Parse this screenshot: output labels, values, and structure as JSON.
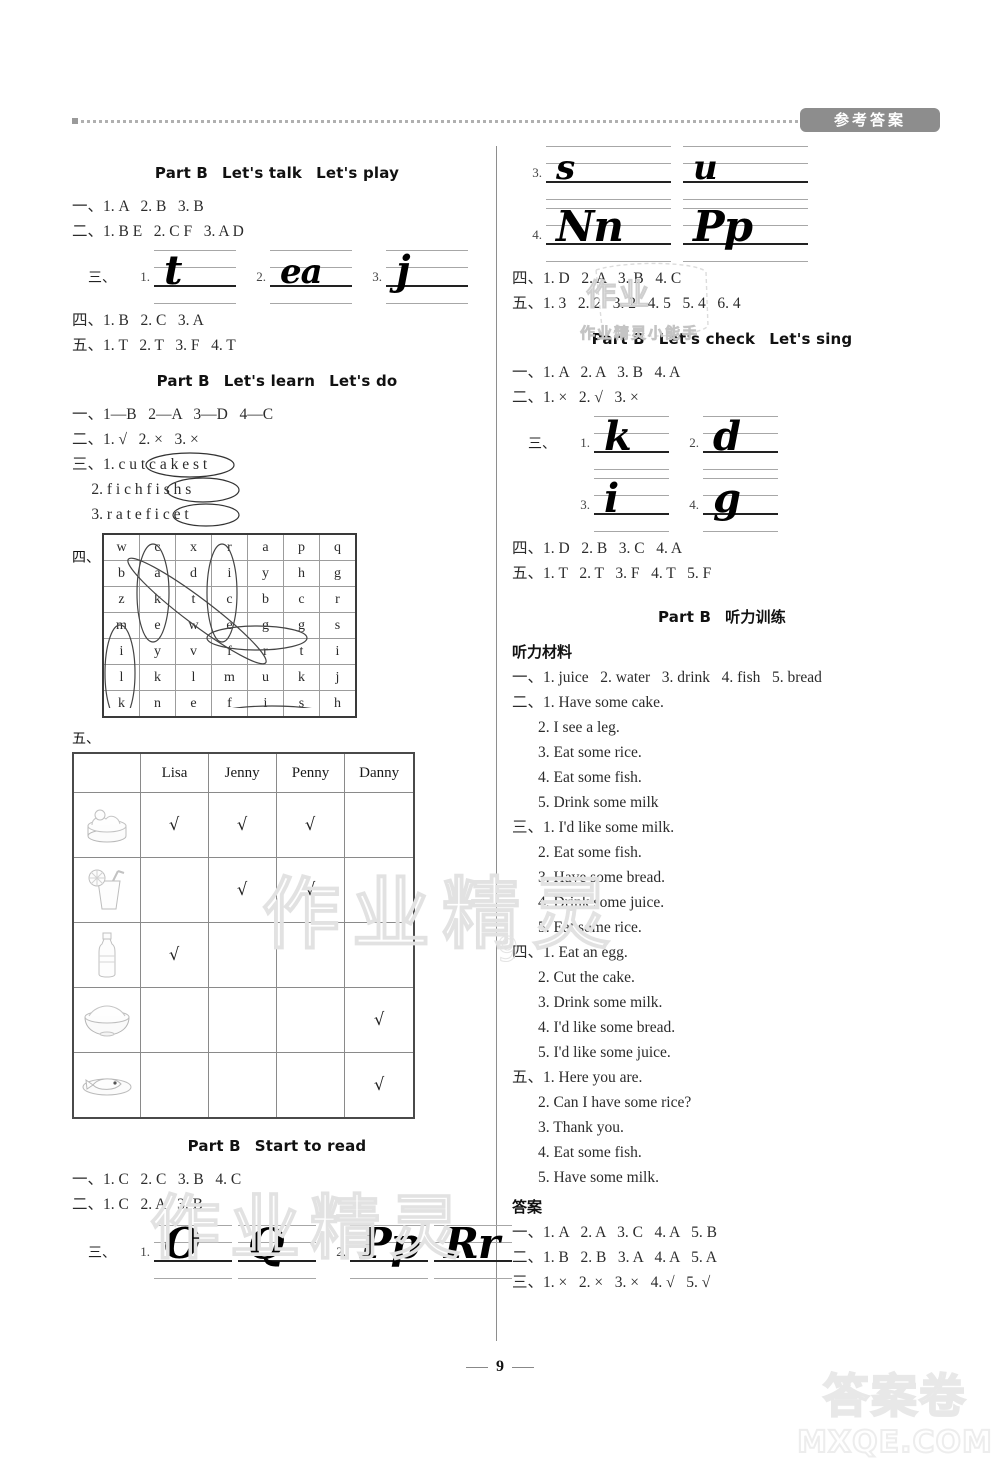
{
  "header": {
    "badge": "参考答案"
  },
  "page_number": "9",
  "watermarks": {
    "main": "作业精灵",
    "secondary": "作业精灵",
    "scribble_top": "作业",
    "scribble_sub": "作业精灵小能手",
    "footer_cn": "答案卷",
    "footer_en": "MXQE.COM",
    "side_digit": "9"
  },
  "left_column": {
    "sections": [
      {
        "title": [
          "Part B",
          "Let's talk",
          "Let's play"
        ],
        "lines": [
          "一、1. A   2. B   3. B",
          "二、1. B E   2. C F   3. A D"
        ],
        "staves": {
          "label": "三、",
          "items": [
            {
              "num": "1.",
              "glyph": "t"
            },
            {
              "num": "2.",
              "glyph": "ea"
            },
            {
              "num": "3.",
              "glyph": "j"
            }
          ]
        },
        "lines_after": [
          "四、1. B   2. C   3. A",
          "五、1. T   2. T   3. F   4. T"
        ]
      },
      {
        "title": [
          "Part B",
          "Let's learn",
          "Let's do"
        ],
        "lines": [
          "一、1—B   2—A   3—D   4—C",
          "二、1. √   2. ×   3. ×",
          "三、1. c u t c a k e s t",
          "     2. f i c h f i s h s",
          "     3. r a t e f i c e t"
        ],
        "circled": [
          {
            "line": 3,
            "text": "c a k e"
          },
          {
            "line": 4,
            "text": "f i s h"
          },
          {
            "line": 5,
            "text": "f i c e"
          }
        ]
      }
    ],
    "wordsearch": {
      "label": "四、",
      "grid": [
        [
          "w",
          "c",
          "x",
          "r",
          "a",
          "p",
          "q"
        ],
        [
          "b",
          "a",
          "d",
          "i",
          "y",
          "h",
          "g"
        ],
        [
          "z",
          "k",
          "t",
          "c",
          "b",
          "c",
          "r"
        ],
        [
          "m",
          "e",
          "w",
          "e",
          "g",
          "g",
          "s"
        ],
        [
          "i",
          "y",
          "v",
          "f",
          "r",
          "t",
          "i"
        ],
        [
          "l",
          "k",
          "l",
          "m",
          "u",
          "k",
          "j"
        ],
        [
          "k",
          "n",
          "e",
          "f",
          "i",
          "s",
          "h"
        ]
      ],
      "found_words": [
        "water",
        "cake",
        "rice",
        "egg",
        "milk",
        "fish"
      ]
    },
    "foodtable": {
      "label": "五、",
      "columns": [
        "",
        "Lisa",
        "Jenny",
        "Penny",
        "Danny"
      ],
      "rows": [
        {
          "icon": "cake-icon",
          "marks": [
            "√",
            "√",
            "√",
            ""
          ]
        },
        {
          "icon": "juice-icon",
          "marks": [
            "",
            "√",
            "√",
            ""
          ]
        },
        {
          "icon": "water-icon",
          "marks": [
            "√",
            "",
            "",
            ""
          ]
        },
        {
          "icon": "rice-icon",
          "marks": [
            "",
            "",
            "",
            "√"
          ]
        },
        {
          "icon": "fish-icon",
          "marks": [
            "",
            "",
            "",
            "√"
          ]
        }
      ]
    },
    "start_to_read": {
      "title": [
        "Part B",
        "Start to read"
      ],
      "lines": [
        "一、1. C   2. C   3. B   4. C",
        "二、1. C   2. A   3. B"
      ],
      "staves": {
        "label": "三、",
        "items": [
          {
            "num": "1.",
            "glyph": "O"
          },
          {
            "num": "",
            "glyph": "Q"
          },
          {
            "num": "2.",
            "glyph": "Pp"
          },
          {
            "num": "",
            "glyph": "Rr"
          }
        ]
      }
    }
  },
  "right_column": {
    "staves_top": {
      "items": [
        {
          "num": "3.",
          "glyph": "s"
        },
        {
          "num": "",
          "glyph": "u"
        },
        {
          "num": "4.",
          "glyph": "Nn"
        },
        {
          "num": "",
          "glyph": "Pp"
        }
      ]
    },
    "lines_top": [
      "四、1. D   2. A   3. B   4. C",
      "五、1. 3   2. 2   3. 2   4. 5   5. 4   6. 4"
    ],
    "lets_check": {
      "title": [
        "Part B",
        "Let's check",
        "Let's sing"
      ],
      "lines": [
        "一、1. A   2. A   3. B   4. A",
        "二、1. ×   2. √   3. ×"
      ],
      "staves": {
        "label": "三、",
        "items": [
          {
            "num": "1.",
            "glyph": "k"
          },
          {
            "num": "2.",
            "glyph": "d"
          },
          {
            "num": "3.",
            "glyph": "i"
          },
          {
            "num": "4.",
            "glyph": "g"
          }
        ]
      },
      "lines_after": [
        "四、1. D   2. B   3. C   4. A",
        "五、1. T   2. T   3. F   4. T   5. F"
      ]
    },
    "listening": {
      "title": [
        "Part B",
        "听力训练"
      ],
      "heading": "听力材料",
      "groups": [
        {
          "first": "一、1. juice   2. water   3. drink   4. fish   5. bread",
          "rest": []
        },
        {
          "first": "二、1. Have some cake.",
          "rest": [
            "2. I see a leg.",
            "3. Eat some rice.",
            "4. Eat some fish.",
            "5. Drink some milk"
          ]
        },
        {
          "first": "三、1. I'd like some milk.",
          "rest": [
            "2. Eat some fish.",
            "3. Have some bread.",
            "4. Drink some juice.",
            "5. Eat some rice."
          ]
        },
        {
          "first": "四、1. Eat an egg.",
          "rest": [
            "2. Cut the cake.",
            "3. Drink some milk.",
            "4. I'd like some bread.",
            "5. I'd like some juice."
          ]
        },
        {
          "first": "五、1. Here you are.",
          "rest": [
            "2. Can I have some rice?",
            "3. Thank you.",
            "4. Eat some fish.",
            "5. Have some milk."
          ]
        }
      ],
      "answers_heading": "答案",
      "answers": [
        "一、1. A   2. A   3. C   4. A   5. B",
        "二、1. B   2. B   3. A   4. A   5. A",
        "三、1. ×   2. ×   3. ×   4. √   5. √"
      ]
    }
  }
}
